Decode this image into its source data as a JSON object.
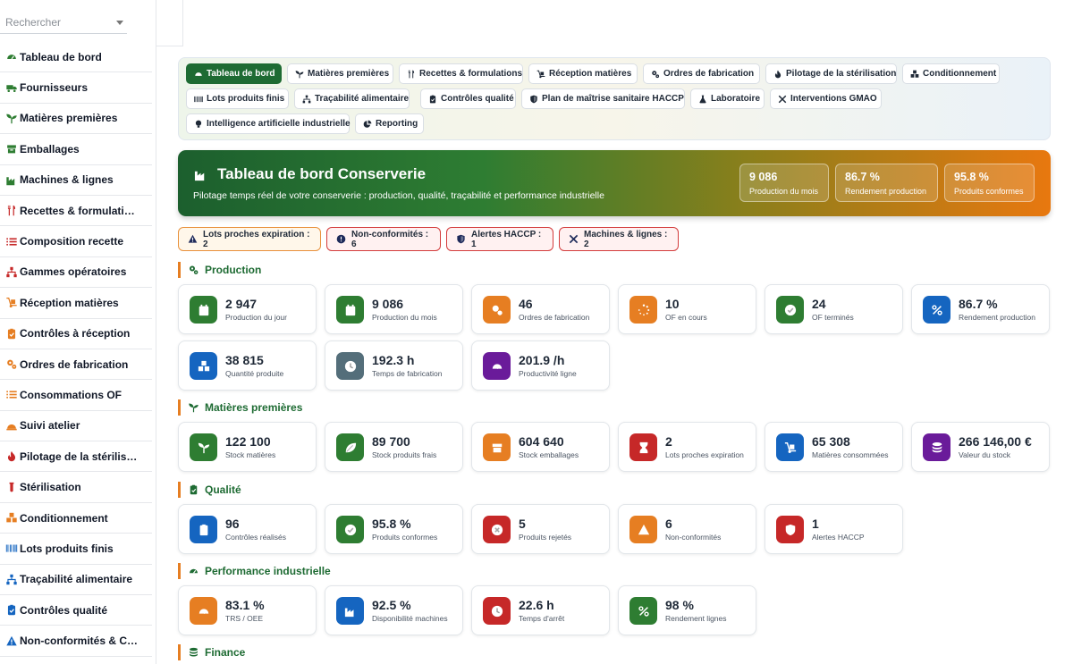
{
  "sidebar": {
    "search_placeholder": "Rechercher",
    "items": [
      {
        "label": "Tableau de bord",
        "icon": "gauge-icon",
        "color": "#2e7d32"
      },
      {
        "label": "Fournisseurs",
        "icon": "truck-icon",
        "color": "#2e7d32"
      },
      {
        "label": "Matières premières",
        "icon": "seedling-icon",
        "color": "#2e7d32"
      },
      {
        "label": "Emballages",
        "icon": "box-icon",
        "color": "#2e7d32"
      },
      {
        "label": "Machines & lignes",
        "icon": "industry-icon",
        "color": "#2e7d32"
      },
      {
        "label": "Recettes & formulati…",
        "icon": "utensils-icon",
        "color": "#c62828"
      },
      {
        "label": "Composition recette",
        "icon": "list-icon",
        "color": "#c62828"
      },
      {
        "label": "Gammes opératoires",
        "icon": "sitemap-icon",
        "color": "#c62828"
      },
      {
        "label": "Réception matières",
        "icon": "dolly-icon",
        "color": "#e67e22"
      },
      {
        "label": "Contrôles à réception",
        "icon": "clipboard-check-icon",
        "color": "#e67e22"
      },
      {
        "label": "Ordres de fabrication",
        "icon": "gears-icon",
        "color": "#e67e22"
      },
      {
        "label": "Consommations OF",
        "icon": "list-icon",
        "color": "#e67e22"
      },
      {
        "label": "Suivi atelier",
        "icon": "hard-hat-icon",
        "color": "#e67e22"
      },
      {
        "label": "Pilotage de la stérilis…",
        "icon": "fire-icon",
        "color": "#c62828"
      },
      {
        "label": "Stérilisation",
        "icon": "vial-icon",
        "color": "#c62828"
      },
      {
        "label": "Conditionnement",
        "icon": "boxes-icon",
        "color": "#e67e22"
      },
      {
        "label": "Lots produits finis",
        "icon": "barcode-icon",
        "color": "#1565c0"
      },
      {
        "label": "Traçabilité alimentaire",
        "icon": "sitemap-icon",
        "color": "#1565c0"
      },
      {
        "label": "Contrôles qualité",
        "icon": "clipboard-check-icon",
        "color": "#1565c0"
      },
      {
        "label": "Non-conformités & C…",
        "icon": "warning-icon",
        "color": "#1565c0"
      }
    ]
  },
  "tabs": [
    {
      "label": "Tableau de bord",
      "icon": "gauge-icon",
      "active": true
    },
    {
      "label": "Matières premières",
      "icon": "seedling-icon"
    },
    {
      "label": "Recettes & formulations",
      "icon": "utensils-icon"
    },
    {
      "label": "Réception matières",
      "icon": "dolly-icon"
    },
    {
      "label": "Ordres de fabrication",
      "icon": "gears-icon"
    },
    {
      "label": "Pilotage de la stérilisation",
      "icon": "fire-icon"
    },
    {
      "label": "Conditionnement",
      "icon": "boxes-icon"
    },
    {
      "label": "Lots produits finis",
      "icon": "barcode-icon"
    },
    {
      "label": "Traçabilité alimentaire",
      "icon": "sitemap-icon"
    },
    {
      "label": "Contrôles qualité",
      "icon": "clipboard-check-icon"
    },
    {
      "label": "Plan de maîtrise sanitaire HACCP",
      "icon": "shield-icon"
    },
    {
      "label": "Laboratoire",
      "icon": "flask-icon"
    },
    {
      "label": "Interventions GMAO",
      "icon": "tools-icon"
    },
    {
      "label": "Intelligence artificielle industrielle",
      "icon": "lightbulb-icon"
    },
    {
      "label": "Reporting",
      "icon": "chart-pie-icon"
    }
  ],
  "banner": {
    "title": "Tableau de bord Conserverie",
    "subtitle": "Pilotage temps réel de votre conserverie : production, qualité, traçabilité et performance industrielle",
    "stats": [
      {
        "value": "9 086",
        "label": "Production du mois"
      },
      {
        "value": "86.7 %",
        "label": "Rendement production"
      },
      {
        "value": "95.8 %",
        "label": "Produits conformes"
      }
    ]
  },
  "alerts": [
    {
      "label": "Lots proches expiration : 2",
      "icon": "warning-icon",
      "style": "orange"
    },
    {
      "label": "Non-conformités : 6",
      "icon": "exclamation-icon",
      "style": "red"
    },
    {
      "label": "Alertes HACCP : 1",
      "icon": "shield-icon",
      "style": "red"
    },
    {
      "label": "Machines & lignes : 2",
      "icon": "tools-icon",
      "style": "red"
    }
  ],
  "sections": [
    {
      "title": "Production",
      "icon": "gears-icon",
      "cards": [
        {
          "value": "2 947",
          "label": "Production du jour",
          "icon": "calendar-icon",
          "color": "#2e7d32"
        },
        {
          "value": "9 086",
          "label": "Production du mois",
          "icon": "calendar-icon",
          "color": "#2e7d32"
        },
        {
          "value": "46",
          "label": "Ordres de fabrication",
          "icon": "gears-icon",
          "color": "#e67e22"
        },
        {
          "value": "10",
          "label": "OF en cours",
          "icon": "spinner-icon",
          "color": "#e67e22"
        },
        {
          "value": "24",
          "label": "OF terminés",
          "icon": "check-circle-icon",
          "color": "#2e7d32"
        },
        {
          "value": "86.7 %",
          "label": "Rendement production",
          "icon": "percent-icon",
          "color": "#1565c0"
        },
        {
          "value": "38 815",
          "label": "Quantité produite",
          "icon": "boxes-icon",
          "color": "#1565c0"
        },
        {
          "value": "192.3 h",
          "label": "Temps de fabrication",
          "icon": "clock-icon",
          "color": "#546e7a"
        },
        {
          "value": "201.9 /h",
          "label": "Productivité ligne",
          "icon": "gauge-icon",
          "color": "#6a1b9a"
        }
      ]
    },
    {
      "title": "Matières premières",
      "icon": "seedling-icon",
      "cards": [
        {
          "value": "122 100",
          "label": "Stock matières",
          "icon": "seedling-icon",
          "color": "#2e7d32"
        },
        {
          "value": "89 700",
          "label": "Stock produits frais",
          "icon": "leaf-icon",
          "color": "#2e7d32"
        },
        {
          "value": "604 640",
          "label": "Stock emballages",
          "icon": "box-icon",
          "color": "#e67e22"
        },
        {
          "value": "2",
          "label": "Lots proches expiration",
          "icon": "hourglass-icon",
          "color": "#c62828"
        },
        {
          "value": "65 308",
          "label": "Matières consommées",
          "icon": "dolly-icon",
          "color": "#1565c0"
        },
        {
          "value": "266 146,00 €",
          "label": "Valeur du stock",
          "icon": "coins-icon",
          "color": "#6a1b9a"
        }
      ]
    },
    {
      "title": "Qualité",
      "icon": "clipboard-check-icon",
      "cards": [
        {
          "value": "96",
          "label": "Contrôles réalisés",
          "icon": "clipboard-check-icon",
          "color": "#1565c0"
        },
        {
          "value": "95.8 %",
          "label": "Produits conformes",
          "icon": "check-circle-icon",
          "color": "#2e7d32"
        },
        {
          "value": "5",
          "label": "Produits rejetés",
          "icon": "times-circle-icon",
          "color": "#c62828"
        },
        {
          "value": "6",
          "label": "Non-conformités",
          "icon": "warning-icon",
          "color": "#e67e22"
        },
        {
          "value": "1",
          "label": "Alertes HACCP",
          "icon": "shield-icon",
          "color": "#c62828"
        }
      ]
    },
    {
      "title": "Performance industrielle",
      "icon": "gauge-icon",
      "cards": [
        {
          "value": "83.1 %",
          "label": "TRS / OEE",
          "icon": "gauge-icon",
          "color": "#e67e22"
        },
        {
          "value": "92.5 %",
          "label": "Disponibilité machines",
          "icon": "industry-icon",
          "color": "#1565c0"
        },
        {
          "value": "22.6 h",
          "label": "Temps d'arrêt",
          "icon": "clock-icon",
          "color": "#c62828"
        },
        {
          "value": "98 %",
          "label": "Rendement lignes",
          "icon": "percent-icon",
          "color": "#2e7d32"
        }
      ]
    },
    {
      "title": "Finance",
      "icon": "coins-icon",
      "cards": []
    }
  ]
}
